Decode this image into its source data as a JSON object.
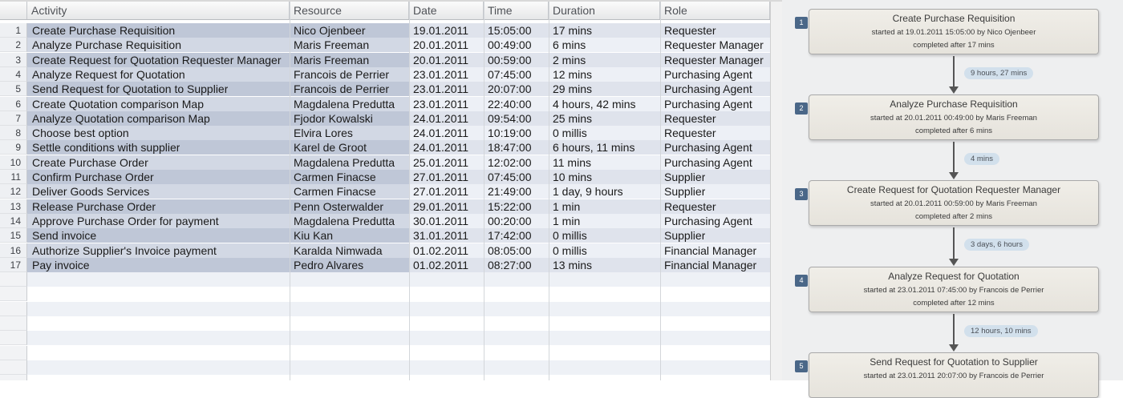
{
  "table": {
    "headers": {
      "activity": "Activity",
      "resource": "Resource",
      "date": "Date",
      "time": "Time",
      "duration": "Duration",
      "role": "Role"
    },
    "rows": [
      {
        "num": "1",
        "activity": "Create Purchase Requisition",
        "resource": "Nico Ojenbeer",
        "date": "19.01.2011",
        "time": "15:05:00",
        "duration": "17 mins",
        "role": "Requester"
      },
      {
        "num": "2",
        "activity": "Analyze Purchase Requisition",
        "resource": "Maris Freeman",
        "date": "20.01.2011",
        "time": "00:49:00",
        "duration": "6 mins",
        "role": "Requester Manager"
      },
      {
        "num": "3",
        "activity": "Create Request for Quotation Requester Manager",
        "resource": "Maris Freeman",
        "date": "20.01.2011",
        "time": "00:59:00",
        "duration": "2 mins",
        "role": "Requester Manager"
      },
      {
        "num": "4",
        "activity": "Analyze Request for Quotation",
        "resource": "Francois de Perrier",
        "date": "23.01.2011",
        "time": "07:45:00",
        "duration": "12 mins",
        "role": "Purchasing Agent"
      },
      {
        "num": "5",
        "activity": "Send Request for Quotation to Supplier",
        "resource": "Francois de Perrier",
        "date": "23.01.2011",
        "time": "20:07:00",
        "duration": "29 mins",
        "role": "Purchasing Agent"
      },
      {
        "num": "6",
        "activity": "Create Quotation comparison Map",
        "resource": "Magdalena Predutta",
        "date": "23.01.2011",
        "time": "22:40:00",
        "duration": "4 hours, 42 mins",
        "role": "Purchasing Agent"
      },
      {
        "num": "7",
        "activity": "Analyze Quotation comparison Map",
        "resource": "Fjodor Kowalski",
        "date": "24.01.2011",
        "time": "09:54:00",
        "duration": "25 mins",
        "role": "Requester"
      },
      {
        "num": "8",
        "activity": "Choose best option",
        "resource": "Elvira Lores",
        "date": "24.01.2011",
        "time": "10:19:00",
        "duration": "0 millis",
        "role": "Requester"
      },
      {
        "num": "9",
        "activity": "Settle conditions with supplier",
        "resource": "Karel de Groot",
        "date": "24.01.2011",
        "time": "18:47:00",
        "duration": "6 hours, 11 mins",
        "role": "Purchasing Agent"
      },
      {
        "num": "10",
        "activity": "Create Purchase Order",
        "resource": "Magdalena Predutta",
        "date": "25.01.2011",
        "time": "12:02:00",
        "duration": "11 mins",
        "role": "Purchasing Agent"
      },
      {
        "num": "11",
        "activity": "Confirm Purchase Order",
        "resource": "Carmen Finacse",
        "date": "27.01.2011",
        "time": "07:45:00",
        "duration": "10 mins",
        "role": "Supplier"
      },
      {
        "num": "12",
        "activity": "Deliver Goods Services",
        "resource": "Carmen Finacse",
        "date": "27.01.2011",
        "time": "21:49:00",
        "duration": "1 day, 9 hours",
        "role": "Supplier"
      },
      {
        "num": "13",
        "activity": "Release Purchase Order",
        "resource": "Penn Osterwalder",
        "date": "29.01.2011",
        "time": "15:22:00",
        "duration": "1 min",
        "role": "Requester"
      },
      {
        "num": "14",
        "activity": "Approve Purchase Order for payment",
        "resource": "Magdalena Predutta",
        "date": "30.01.2011",
        "time": "00:20:00",
        "duration": "1 min",
        "role": "Purchasing Agent"
      },
      {
        "num": "15",
        "activity": "Send invoice",
        "resource": "Kiu Kan",
        "date": "31.01.2011",
        "time": "17:42:00",
        "duration": "0 millis",
        "role": "Supplier"
      },
      {
        "num": "16",
        "activity": "Authorize Supplier's Invoice payment",
        "resource": "Karalda Nimwada",
        "date": "01.02.2011",
        "time": "08:05:00",
        "duration": "0 millis",
        "role": "Financial Manager"
      },
      {
        "num": "17",
        "activity": "Pay invoice",
        "resource": "Pedro Alvares",
        "date": "01.02.2011",
        "time": "08:27:00",
        "duration": "13 mins",
        "role": "Financial Manager"
      }
    ]
  },
  "diagram": {
    "nodes": [
      {
        "num": "1",
        "title": "Create Purchase Requisition",
        "started": "started at 19.01.2011 15:05:00 by Nico Ojenbeer",
        "completed": "completed after 17 mins"
      },
      {
        "num": "2",
        "title": "Analyze Purchase Requisition",
        "started": "started at 20.01.2011 00:49:00 by Maris Freeman",
        "completed": "completed after 6 mins"
      },
      {
        "num": "3",
        "title": "Create Request for Quotation Requester Manager",
        "started": "started at 20.01.2011 00:59:00 by Maris Freeman",
        "completed": "completed after 2 mins"
      },
      {
        "num": "4",
        "title": "Analyze Request for Quotation",
        "started": "started at 23.01.2011 07:45:00 by Francois de Perrier",
        "completed": "completed after 12 mins"
      },
      {
        "num": "5",
        "title": "Send Request for Quotation to Supplier",
        "started": "started at 23.01.2011 20:07:00 by Francois de Perrier",
        "completed": ""
      }
    ],
    "gaps": [
      "9 hours, 27 mins",
      "4 mins",
      "3 days, 6 hours",
      "12 hours, 10 mins"
    ]
  }
}
